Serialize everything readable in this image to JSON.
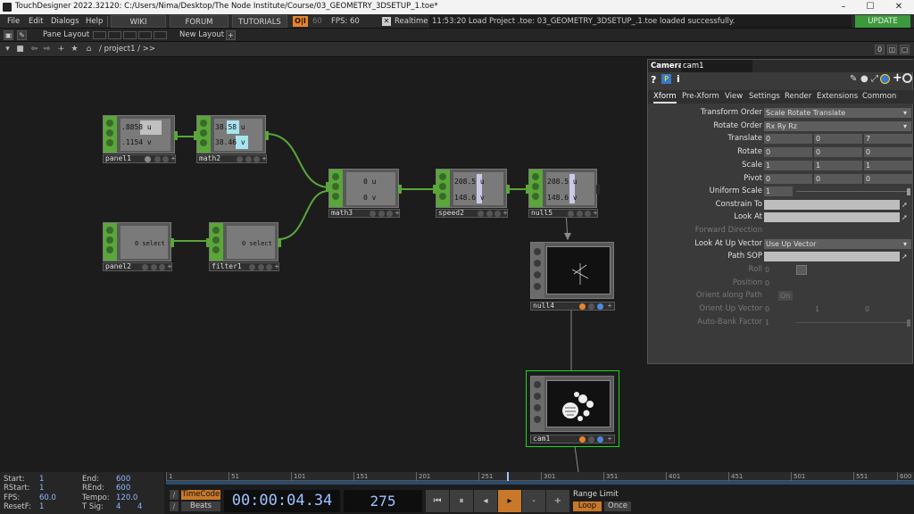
{
  "window": {
    "title": "TouchDesigner 2022.32120: C:/Users/Nima/Desktop/The Node Institute/Course/03_GEOMETRY_3DSETUP_1.toe*",
    "min": "–",
    "max": "☐",
    "close": "✕"
  },
  "menu": [
    "File",
    "Edit",
    "Dialogs",
    "Help"
  ],
  "toolbar": {
    "wiki": "WIKI",
    "forum": "FORUM",
    "tutorials": "TUTORIALS",
    "oi": "O|I",
    "fps_target": "60",
    "fps_label": "FPS:",
    "fps_value": "60",
    "realtime_check": "✕",
    "realtime_label": "Realtime",
    "status": "11:53:20 Load Project .toe: 03_GEOMETRY_3DSETUP_.1.toe loaded successfully.",
    "update": "UPDATE"
  },
  "layoutbar": {
    "pane_layout": "Pane Layout",
    "new_layout": "New Layout",
    "plus": "+",
    "right_btn": "0"
  },
  "pathbar": {
    "path": "/ project1 / >>"
  },
  "nodes": {
    "panel1": {
      "name": "panel1",
      "v1": ".8858 u",
      "v2": ".1154 v"
    },
    "math2": {
      "name": "math2",
      "v1": "38.58 u",
      "v2": "38.46 v"
    },
    "math3": {
      "name": "math3",
      "v1": "0 u",
      "v2": "0 v"
    },
    "speed2": {
      "name": "speed2",
      "v1": "208.5 u",
      "v2": "148.6 v"
    },
    "null5": {
      "name": "null5",
      "v1": "208.5 u",
      "v2": "148.6 v"
    },
    "panel2": {
      "name": "panel2",
      "v1": "0 select"
    },
    "filter1": {
      "name": "filter1",
      "v1": "0 select"
    },
    "null4": {
      "name": "null4"
    },
    "cam1": {
      "name": "cam1"
    }
  },
  "params": {
    "optype": "Camera",
    "opname": "cam1",
    "help": "?",
    "info": "i",
    "tabs": [
      "Xform",
      "Pre-Xform",
      "View",
      "Settings",
      "Render",
      "Extensions",
      "Common"
    ],
    "transform_order": {
      "label": "Transform Order",
      "value": "Scale Rotate Translate"
    },
    "rotate_order": {
      "label": "Rotate Order",
      "value": "Rx Ry Rz"
    },
    "translate": {
      "label": "Translate",
      "x": "0",
      "y": "0",
      "z": "7"
    },
    "rotate": {
      "label": "Rotate",
      "x": "0",
      "y": "0",
      "z": "0"
    },
    "scale": {
      "label": "Scale",
      "x": "1",
      "y": "1",
      "z": "1"
    },
    "pivot": {
      "label": "Pivot",
      "x": "0",
      "y": "0",
      "z": "0"
    },
    "uniform_scale": {
      "label": "Uniform Scale",
      "value": "1"
    },
    "constrain_to": {
      "label": "Constrain To"
    },
    "look_at": {
      "label": "Look At"
    },
    "forward_direction": {
      "label": "Forward Direction"
    },
    "look_at_up": {
      "label": "Look At Up Vector",
      "value": "Use Up Vector"
    },
    "path_sop": {
      "label": "Path SOP"
    },
    "roll": {
      "label": "Roll",
      "value": "0"
    },
    "position": {
      "label": "Position",
      "value": "0"
    },
    "orient_path": {
      "label": "Orient along Path",
      "value": "On"
    },
    "orient_up": {
      "label": "Orient Up Vector",
      "x": "0",
      "y": "1",
      "z": "0"
    },
    "auto_bank": {
      "label": "Auto-Bank Factor",
      "value": "1"
    }
  },
  "timeline": {
    "ticks": [
      "1",
      "51",
      "101",
      "151",
      "201",
      "251",
      "301",
      "351",
      "401",
      "451",
      "501",
      "551",
      "600"
    ],
    "start_label": "Start:",
    "start": "1",
    "rstart_label": "RStart:",
    "rstart": "1",
    "fps_label": "FPS:",
    "fps": "60.0",
    "resetf_label": "ResetF:",
    "resetf": "1",
    "end_label": "End:",
    "end": "600",
    "rend_label": "REnd:",
    "rend": "600",
    "tempo_label": "Tempo:",
    "tempo": "120.0",
    "tsig_label": "T Sig:",
    "tsig1": "4",
    "tsig2": "4",
    "timecode_btn": "TimeCode",
    "beats_btn": "Beats",
    "timecode": "00:00:04.34",
    "frame": "275",
    "range_limit": "Range Limit",
    "loop": "Loop",
    "once": "Once"
  }
}
